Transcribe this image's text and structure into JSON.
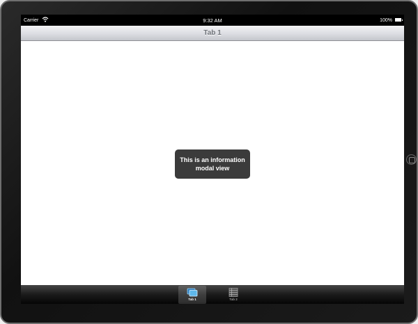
{
  "status_bar": {
    "carrier": "Carrier",
    "time": "9:32 AM",
    "battery": "100%"
  },
  "nav_bar": {
    "title": "Tab 1"
  },
  "modal": {
    "line1": "This is an information",
    "line2": "modal view"
  },
  "tab_bar": {
    "tabs": [
      {
        "label": "Tab 1",
        "icon": "screens-icon",
        "selected": true
      },
      {
        "label": "Tab 2",
        "icon": "grid-list-icon",
        "selected": false
      }
    ]
  },
  "colors": {
    "modal_background": "#3b3b3b",
    "tab_selected_icon": "#5fb8ea"
  }
}
